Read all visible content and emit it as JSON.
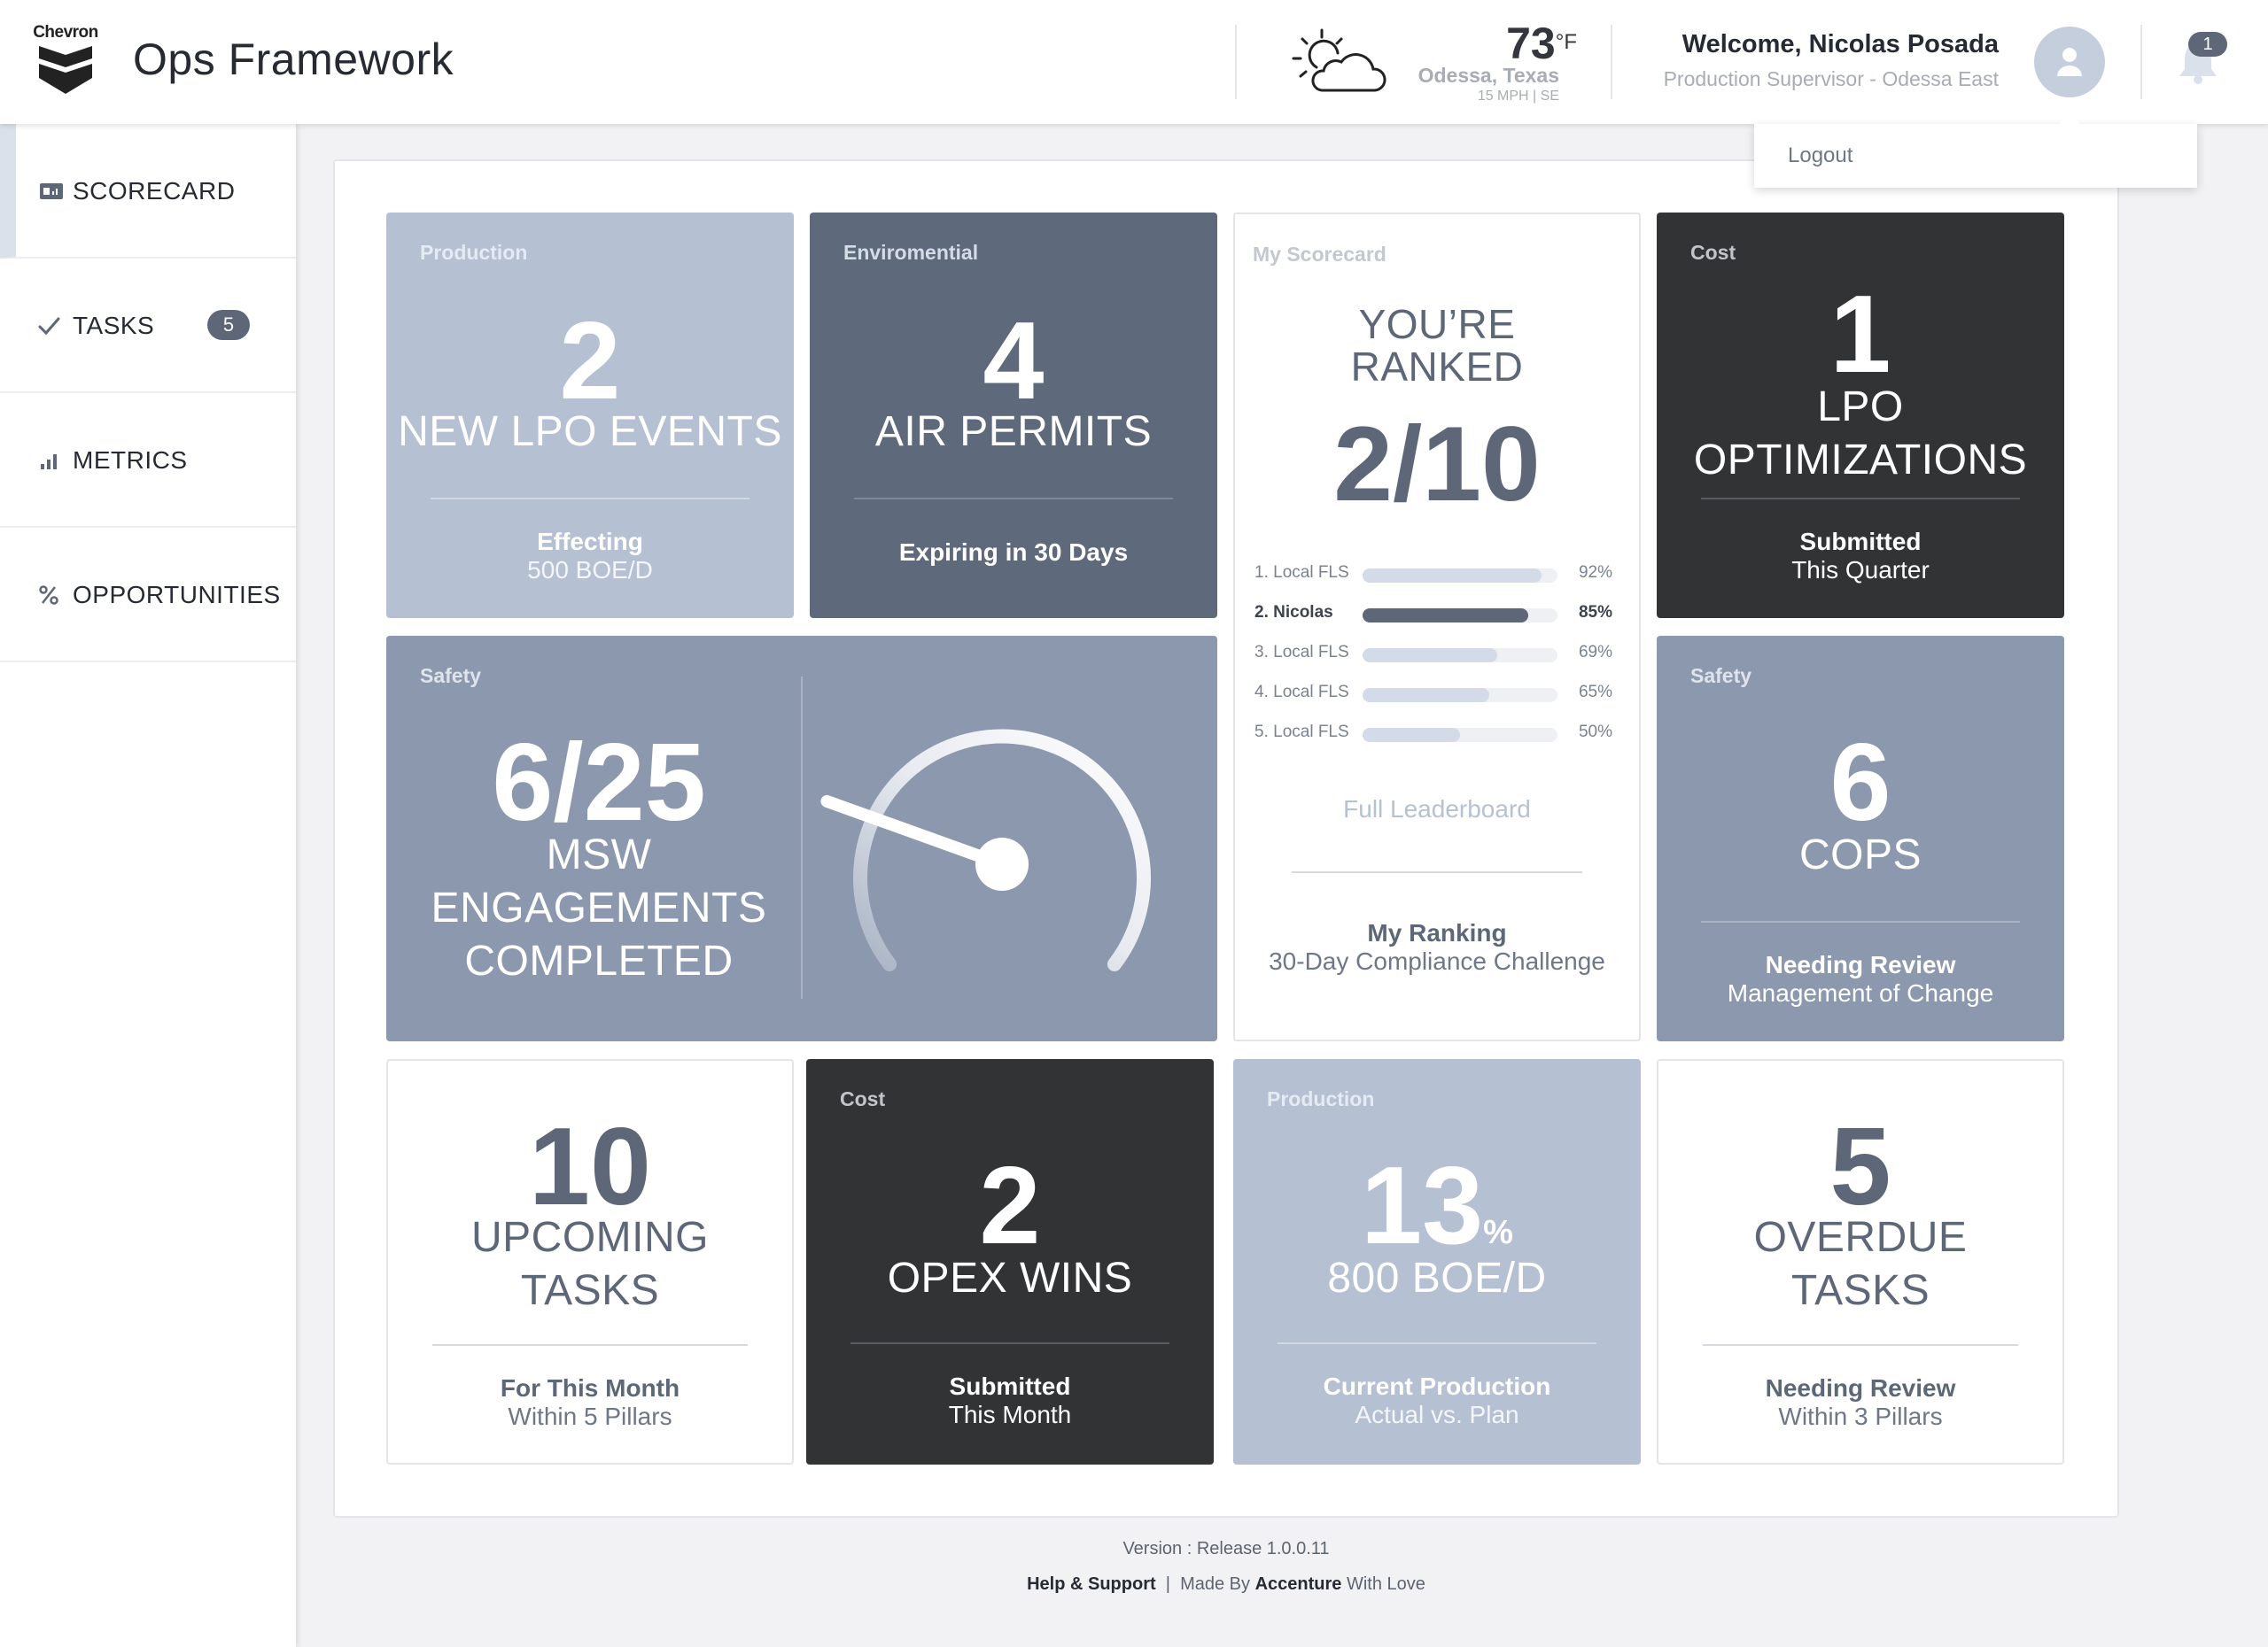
{
  "header": {
    "logo_text": "Chevron",
    "app_title": "Ops Framework",
    "weather": {
      "icon": "partly-cloudy-icon",
      "temp": "73",
      "unit": "°F",
      "city": "Odessa, Texas",
      "wind": "15 MPH | SE"
    },
    "user": {
      "welcome": "Welcome, Nicolas Posada",
      "role": "Production Supervisor - Odessa  East"
    },
    "notifications": {
      "count": "1"
    },
    "dropdown": {
      "logout": "Logout"
    }
  },
  "sidebar": {
    "items": [
      {
        "label": "SCORECARD",
        "icon": "scorecard-icon",
        "active": true
      },
      {
        "label": "TASKS",
        "icon": "check-icon",
        "badge": "5"
      },
      {
        "label": "METRICS",
        "icon": "bar-chart-icon"
      },
      {
        "label": "OPPORTUNITIES",
        "icon": "percent-icon"
      }
    ]
  },
  "cards": {
    "production_lpo": {
      "category": "Production",
      "value": "2",
      "label": "NEW LPO EVENTS",
      "foot1": "Effecting",
      "foot2": "500 BOE/D"
    },
    "air_permits": {
      "category": "Enviromential",
      "value": "4",
      "label": "AIR PERMITS",
      "foot1": "Expiring in 30 Days"
    },
    "scorecard": {
      "category": "My Scorecard",
      "headline1": "YOU’RE",
      "headline2": "RANKED",
      "rank": "2/10",
      "leaderboard": [
        {
          "name": "1. Local FLS",
          "pct_label": "92%",
          "pct": 0.92
        },
        {
          "name": "2. Nicolas",
          "pct_label": "85%",
          "pct": 0.85
        },
        {
          "name": "3. Local FLS",
          "pct_label": "69%",
          "pct": 0.69
        },
        {
          "name": "4. Local FLS",
          "pct_label": "65%",
          "pct": 0.65
        },
        {
          "name": "5. Local FLS",
          "pct_label": "50%",
          "pct": 0.5
        }
      ],
      "link": "Full Leaderboard",
      "foot1": "My Ranking",
      "foot2": "30-Day Compliance Challenge"
    },
    "cost_lpo": {
      "category": "Cost",
      "value": "1",
      "label1": "LPO",
      "label2": "OPTIMIZATIONS",
      "foot1": "Submitted",
      "foot2": "This Quarter"
    },
    "safety_msw": {
      "category": "Safety",
      "value": "6/25",
      "label1": "MSW",
      "label2": "ENGAGEMENTS",
      "label3": "COMPLETED",
      "gauge_fraction": 0.24
    },
    "safety_cops": {
      "category": "Safety",
      "value": "6",
      "label": "COPS",
      "foot1": "Needing Review",
      "foot2": "Management of Change"
    },
    "upcoming": {
      "value": "10",
      "label1": "UPCOMING",
      "label2": "TASKS",
      "foot1": "For This Month",
      "foot2": "Within 5 Pillars"
    },
    "opex": {
      "category": "Cost",
      "value": "2",
      "label": "OPEX WINS",
      "foot1": "Submitted",
      "foot2": "This Month"
    },
    "production_current": {
      "category": "Production",
      "value": "13",
      "unit": "%",
      "label": "800 BOE/D",
      "foot1": "Current Production",
      "foot2": "Actual vs. Plan"
    },
    "overdue": {
      "value": "5",
      "label1": "OVERDUE",
      "label2": "TASKS",
      "foot1": "Needing Review",
      "foot2": "Within 3 Pillars"
    }
  },
  "footer": {
    "version": "Version : Release 1.0.0.11",
    "help": "Help & Support",
    "sep": "|",
    "made_by": "Made By",
    "company": "Accenture",
    "with_love": "With Love"
  }
}
